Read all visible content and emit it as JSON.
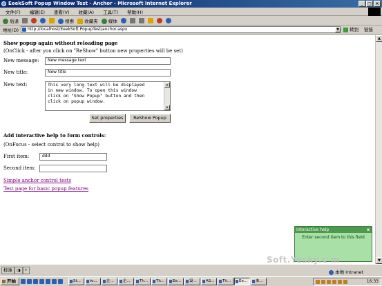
{
  "window": {
    "title": "EeekSoft Popup Window Test - Anchor - Microsoft Internet Explorer",
    "controls": [
      "_",
      "□",
      "×"
    ]
  },
  "menu": [
    "文件(F)",
    "编辑(E)",
    "查看(V)",
    "收藏(A)",
    "工具(T)",
    "帮助(H)"
  ],
  "toolbar": {
    "back": "后退",
    "search": "搜索",
    "favorites": "收藏夹",
    "media": "媒体"
  },
  "address": {
    "label": "地址(D)",
    "url": "http://localhost/EeekSoft.PopupTest/anchor.aspx",
    "go": "转到",
    "links": "链接"
  },
  "section1": {
    "heading": "Show popup again without reloading page",
    "note": "(OnClick - after you click on \"ReShow\" button new properties will be set)",
    "message_label": "New message:",
    "message_value": "New message text",
    "title_label": "New title:",
    "title_value": "New title",
    "text_label": "New text:",
    "text_lines": [
      "This very long text will be displayed",
      "in new window. To open this window",
      "click on \"Show Popup\" button and then",
      "click on popup window."
    ],
    "set_button": "Set properties",
    "reshow_button": "ReShow Popup"
  },
  "section2": {
    "heading": "Add interactive help to form controls:",
    "note": "(OnFocus - select control to show help)",
    "first_label": "First item:",
    "first_value": "ddd",
    "second_label": "Second item:",
    "second_value": ""
  },
  "links_list": [
    "Simple anchor control tests",
    "Test page for basic popup features"
  ],
  "help_popup": {
    "title": "Interactive help",
    "close": "x",
    "message": "Enter second item to this field"
  },
  "langbar": [
    "标准",
    "◑",
    "•"
  ],
  "status": {
    "zone": "本地 Intranet"
  },
  "watermark": "Soft.Yesky.c m",
  "taskbar": {
    "start": "开始",
    "tasks": [
      "St...",
      "to...",
      "企...",
      "企...",
      "Th...",
      "Th...",
      "Ee...",
      "设...",
      "AS...",
      "Th...",
      "Ee...",
      "未..."
    ],
    "clock": "16:33"
  }
}
